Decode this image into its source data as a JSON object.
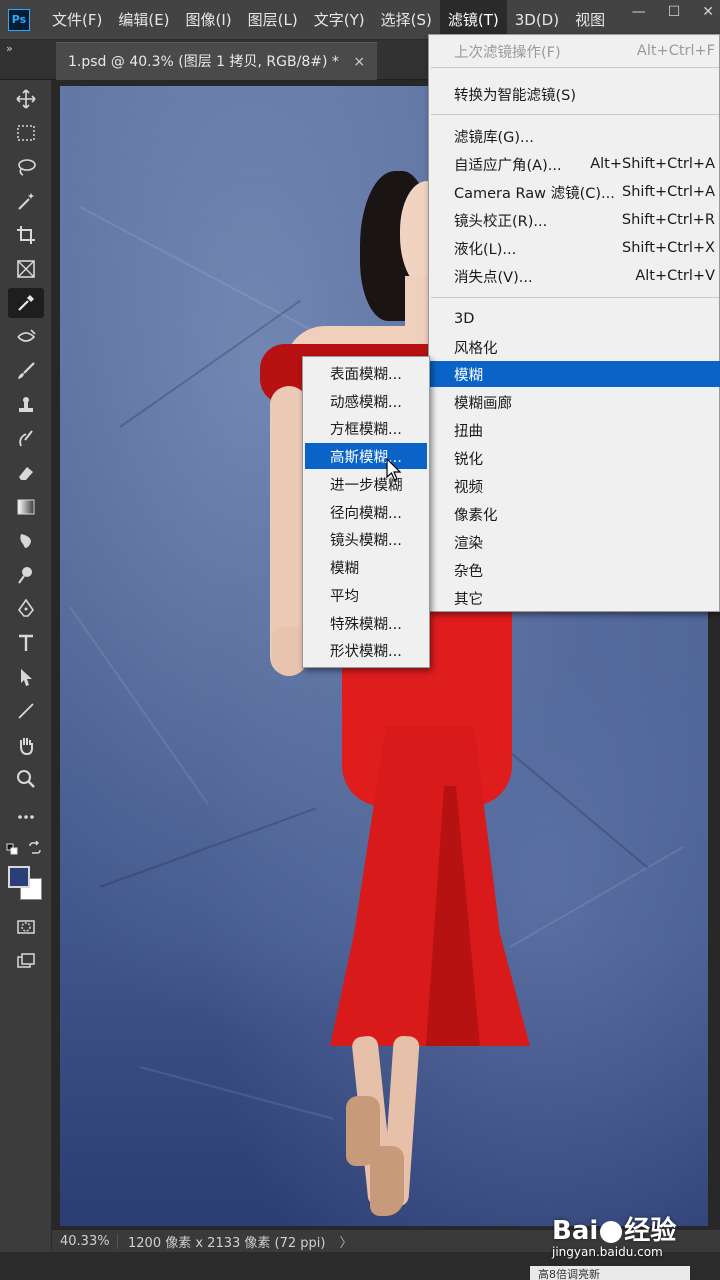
{
  "menubar": {
    "logo": "Ps",
    "items": [
      "文件(F)",
      "编辑(E)",
      "图像(I)",
      "图层(L)",
      "文字(Y)",
      "选择(S)",
      "滤镜(T)",
      "3D(D)",
      "视图"
    ],
    "active_index": 6,
    "window_controls": [
      "minimize-icon",
      "maximize-icon",
      "close-icon"
    ]
  },
  "doc_tab": {
    "title": "1.psd @ 40.3% (图层 1 拷贝, RGB/8#) *",
    "close": "×"
  },
  "collapse_glyph": "»",
  "filter_menu": {
    "items": [
      {
        "label": "上次滤镜操作(F)",
        "shortcut": "Alt+Ctrl+F",
        "disabled": true
      },
      {
        "label": "转换为智能滤镜(S)",
        "shortcut": ""
      },
      {
        "label": "滤镜库(G)...",
        "shortcut": ""
      },
      {
        "label": "自适应广角(A)...",
        "shortcut": "Alt+Shift+Ctrl+A"
      },
      {
        "label": "Camera Raw 滤镜(C)...",
        "shortcut": "Shift+Ctrl+A"
      },
      {
        "label": "镜头校正(R)...",
        "shortcut": "Shift+Ctrl+R"
      },
      {
        "label": "液化(L)...",
        "shortcut": "Shift+Ctrl+X"
      },
      {
        "label": "消失点(V)...",
        "shortcut": "Alt+Ctrl+V"
      },
      {
        "label": "3D",
        "shortcut": ""
      },
      {
        "label": "风格化",
        "shortcut": ""
      },
      {
        "label": "模糊",
        "shortcut": "",
        "highlighted": true
      },
      {
        "label": "模糊画廊",
        "shortcut": ""
      },
      {
        "label": "扭曲",
        "shortcut": ""
      },
      {
        "label": "锐化",
        "shortcut": ""
      },
      {
        "label": "视频",
        "shortcut": ""
      },
      {
        "label": "像素化",
        "shortcut": ""
      },
      {
        "label": "渲染",
        "shortcut": ""
      },
      {
        "label": "杂色",
        "shortcut": ""
      },
      {
        "label": "其它",
        "shortcut": ""
      }
    ]
  },
  "blur_submenu": {
    "items": [
      "表面模糊...",
      "动感模糊...",
      "方框模糊...",
      "高斯模糊...",
      "进一步模糊",
      "径向模糊...",
      "镜头模糊...",
      "模糊",
      "平均",
      "特殊模糊...",
      "形状模糊..."
    ],
    "highlighted_index": 3
  },
  "status": {
    "zoom": "40.33%",
    "info": "1200 像素 x 2133 像素 (72 ppi)",
    "arrow": "〉"
  },
  "watermark": {
    "brand_left": "Bai",
    "brand_right": "经验",
    "url": "jingyan.baidu.com"
  },
  "bottom_peek": "高8倍调亮新",
  "colors": {
    "menu_highlight": "#0a64c8",
    "foreground_swatch": "#2c3e78",
    "background_swatch": "#ffffff",
    "dress": "#e01d1d"
  }
}
